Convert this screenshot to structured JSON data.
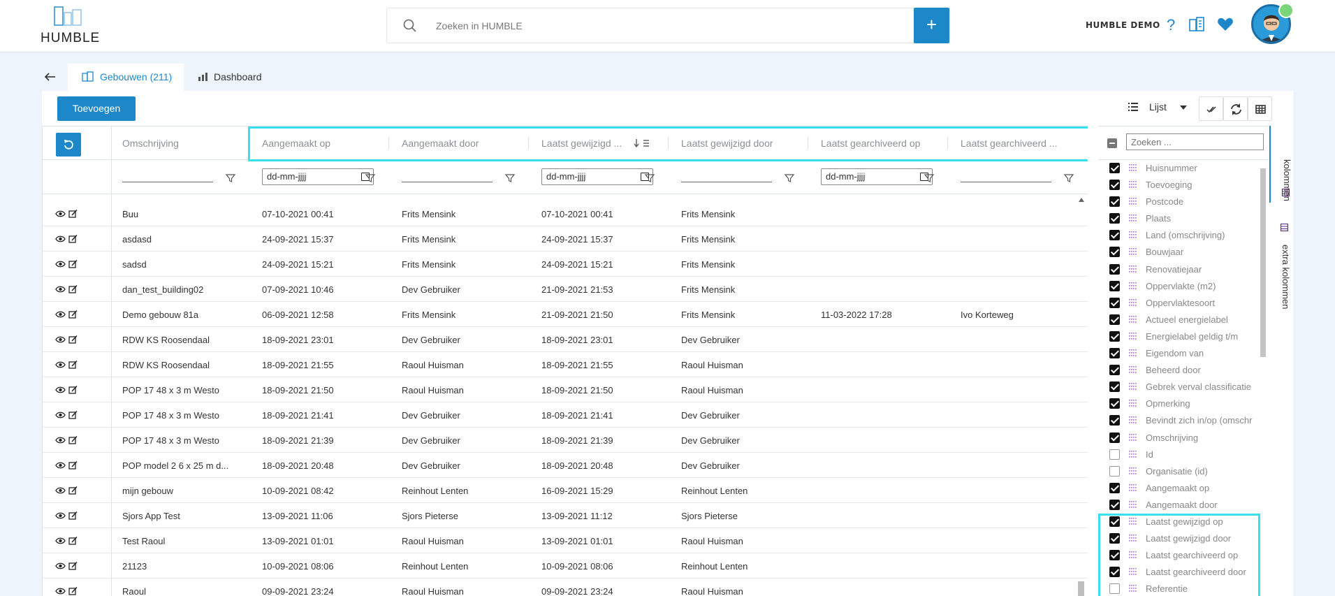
{
  "brand": {
    "name": "HUMBLE"
  },
  "search": {
    "placeholder": "Zoeken in HUMBLE"
  },
  "header": {
    "account_name": "HUMBLE DEMO"
  },
  "tabs": [
    {
      "label": "Gebouwen (211)",
      "icon": "buildings-icon",
      "active": true
    },
    {
      "label": "Dashboard",
      "icon": "chart-icon",
      "active": false
    }
  ],
  "toolbar": {
    "add_label": "Toevoegen",
    "view_label": "Lijst"
  },
  "grid": {
    "columns": [
      "Omschrijving",
      "Aangemaakt op",
      "Aangemaakt door",
      "Laatst gewijzigd ...",
      "Laatst gewijzigd door",
      "Laatst gearchiveerd op",
      "Laatst gearchiveerd ..."
    ],
    "date_placeholder": "dd-mm-jjjj",
    "rows": [
      [
        "Buu",
        "07-10-2021 00:41",
        "Frits Mensink",
        "07-10-2021 00:41",
        "Frits Mensink",
        "",
        ""
      ],
      [
        "asdasd",
        "24-09-2021 15:37",
        "Frits Mensink",
        "24-09-2021 15:37",
        "Frits Mensink",
        "",
        ""
      ],
      [
        "sadsd",
        "24-09-2021 15:21",
        "Frits Mensink",
        "24-09-2021 15:21",
        "Frits Mensink",
        "",
        ""
      ],
      [
        "dan_test_building02",
        "07-09-2021 10:46",
        "Dev Gebruiker",
        "21-09-2021 21:53",
        "Frits Mensink",
        "",
        ""
      ],
      [
        "Demo gebouw 81a",
        "06-09-2021 12:58",
        "Frits Mensink",
        "21-09-2021 21:50",
        "Frits Mensink",
        "11-03-2022 17:28",
        "Ivo Korteweg"
      ],
      [
        "RDW KS Roosendaal",
        "18-09-2021 23:01",
        "Dev Gebruiker",
        "18-09-2021 23:01",
        "Dev Gebruiker",
        "",
        ""
      ],
      [
        "RDW KS Roosendaal",
        "18-09-2021 21:55",
        "Raoul Huisman",
        "18-09-2021 21:55",
        "Raoul Huisman",
        "",
        ""
      ],
      [
        "POP 17 48 x 3 m Westo",
        "18-09-2021 21:50",
        "Raoul Huisman",
        "18-09-2021 21:50",
        "Raoul Huisman",
        "",
        ""
      ],
      [
        "POP 17 48 x 3 m Westo",
        "18-09-2021 21:41",
        "Dev Gebruiker",
        "18-09-2021 21:41",
        "Dev Gebruiker",
        "",
        ""
      ],
      [
        "POP 17 48 x 3 m Westo",
        "18-09-2021 21:39",
        "Dev Gebruiker",
        "18-09-2021 21:39",
        "Dev Gebruiker",
        "",
        ""
      ],
      [
        "POP model 2 6 x 25 m d...",
        "18-09-2021 20:48",
        "Dev Gebruiker",
        "18-09-2021 20:48",
        "Dev Gebruiker",
        "",
        ""
      ],
      [
        "mijn gebouw",
        "10-09-2021 08:42",
        "Reinhout Lenten",
        "16-09-2021 15:29",
        "Reinhout Lenten",
        "",
        ""
      ],
      [
        "Sjors App Test",
        "13-09-2021 11:06",
        "Sjors Pieterse",
        "13-09-2021 11:12",
        "Sjors Pieterse",
        "",
        ""
      ],
      [
        "Test Raoul",
        "13-09-2021 01:01",
        "Raoul Huisman",
        "13-09-2021 01:01",
        "Raoul Huisman",
        "",
        ""
      ],
      [
        "21123",
        "10-09-2021 08:06",
        "Reinhout Lenten",
        "10-09-2021 08:06",
        "Reinhout Lenten",
        "",
        ""
      ],
      [
        "Raoul",
        "09-09-2021 23:24",
        "Raoul Huisman",
        "09-09-2021 23:24",
        "Raoul Huisman",
        "",
        ""
      ]
    ]
  },
  "column_chooser": {
    "search_placeholder": "Zoeken ...",
    "items": [
      {
        "label": "Huisnummer",
        "checked": true
      },
      {
        "label": "Toevoeging",
        "checked": true
      },
      {
        "label": "Postcode",
        "checked": true
      },
      {
        "label": "Plaats",
        "checked": true
      },
      {
        "label": "Land (omschrijving)",
        "checked": true
      },
      {
        "label": "Bouwjaar",
        "checked": true
      },
      {
        "label": "Renovatiejaar",
        "checked": true
      },
      {
        "label": "Oppervlakte (m2)",
        "checked": true
      },
      {
        "label": "Oppervlaktesoort",
        "checked": true
      },
      {
        "label": "Actueel energielabel",
        "checked": true
      },
      {
        "label": "Energielabel geldig t/m",
        "checked": true
      },
      {
        "label": "Eigendom van",
        "checked": true
      },
      {
        "label": "Beheerd door",
        "checked": true
      },
      {
        "label": "Gebrek verval classificatie",
        "checked": true
      },
      {
        "label": "Opmerking",
        "checked": true
      },
      {
        "label": "Bevindt zich in/op (omschr",
        "checked": true
      },
      {
        "label": "Omschrijving",
        "checked": true
      },
      {
        "label": "Id",
        "checked": false
      },
      {
        "label": "Organisatie (id)",
        "checked": false
      },
      {
        "label": "Aangemaakt op",
        "checked": true
      },
      {
        "label": "Aangemaakt door",
        "checked": true
      },
      {
        "label": "Laatst gewijzigd op",
        "checked": true
      },
      {
        "label": "Laatst gewijzigd door",
        "checked": true
      },
      {
        "label": "Laatst gearchiveerd op",
        "checked": true
      },
      {
        "label": "Laatst gearchiveerd door",
        "checked": true
      },
      {
        "label": "Referentie",
        "checked": false
      }
    ]
  },
  "side_tabs": [
    "kolommen",
    "extra kolommen"
  ],
  "colors": {
    "accent": "#1d88c9",
    "highlight": "#36e0ee"
  }
}
